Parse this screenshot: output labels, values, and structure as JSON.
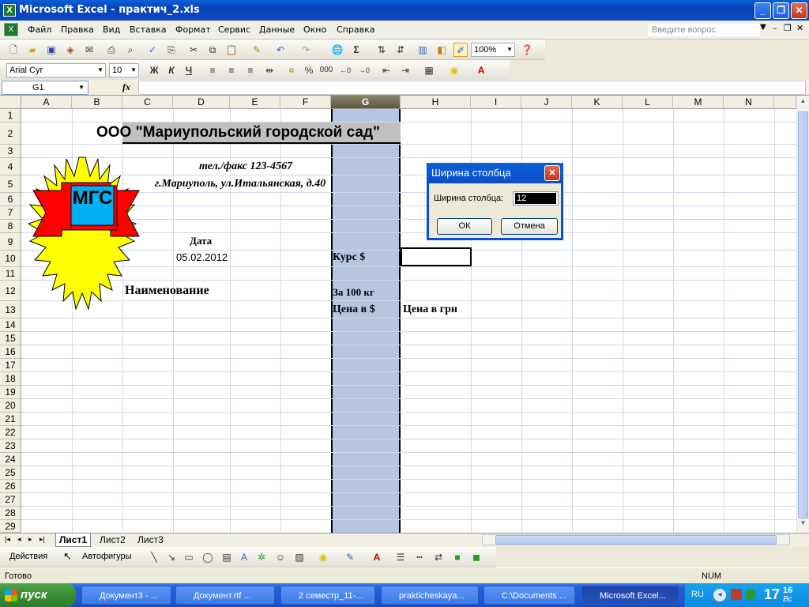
{
  "window": {
    "title": "Microsoft Excel - практич_2.xls",
    "btn_min": "_",
    "btn_max": "❐",
    "btn_close": "✕"
  },
  "menu": {
    "items": [
      "Файл",
      "Правка",
      "Вид",
      "Вставка",
      "Формат",
      "Сервис",
      "Данные",
      "Окно",
      "Справка"
    ],
    "ask_placeholder": "Введите вопрос"
  },
  "toolbar": {
    "zoom": "100%",
    "font": "Arial Cyr",
    "size": "10",
    "bold": "Ж",
    "italic": "К",
    "underline": "Ч",
    "percent": "%",
    "thousands": "000",
    "sigma": "Σ"
  },
  "formula": {
    "cell_ref": "G1",
    "fx": "fx"
  },
  "columns": [
    "A",
    "B",
    "C",
    "D",
    "E",
    "F",
    "G",
    "H",
    "I",
    "J",
    "K",
    "L",
    "M",
    "N"
  ],
  "rows": [
    "1",
    "2",
    "3",
    "4",
    "5",
    "6",
    "7",
    "8",
    "9",
    "10",
    "11",
    "12",
    "13",
    "14",
    "15",
    "16",
    "17",
    "18",
    "19",
    "20",
    "21",
    "22",
    "23",
    "24",
    "25",
    "26",
    "27",
    "28",
    "29"
  ],
  "sheet": {
    "company": "ООО \"Мариупольский городской сад\"",
    "phone": "тел./факс 123-4567",
    "address": "г.Мариуполь, ул.Итальянская, д.40",
    "date_label": "Дата",
    "date_value": "05.02.2012",
    "rate_label": "Курс $",
    "name_label": "Наименование",
    "per100": "За 100 кг",
    "price_usd": "Цена в $",
    "price_uah": "Цена в грн",
    "logo_text": "МГС"
  },
  "sheet_tabs": [
    "Лист1",
    "Лист2",
    "Лист3"
  ],
  "draw_toolbar": {
    "actions": "Действия",
    "autoshapes": "Автофигуры"
  },
  "status": {
    "left": "Готово",
    "num": "NUM"
  },
  "dialog": {
    "title": "Ширина столбца",
    "label": "Ширина столбца:",
    "value": "12",
    "ok": "ОК",
    "cancel": "Отмена"
  },
  "taskbar": {
    "start": "пуск",
    "tasks": [
      "Документ3 - ...",
      "Документ.rtf ...",
      "2 семестр_11-...",
      "prakticheskaya...",
      "C:\\Documents ...",
      "Microsoft Excel..."
    ],
    "lang": "RU",
    "time_h": "17",
    "time_m": "16",
    "day": "Вс"
  },
  "colors": {
    "selected_column": "#b6c5e0",
    "title_blue": "#0a5fd8",
    "start_green": "#3c8f38"
  }
}
